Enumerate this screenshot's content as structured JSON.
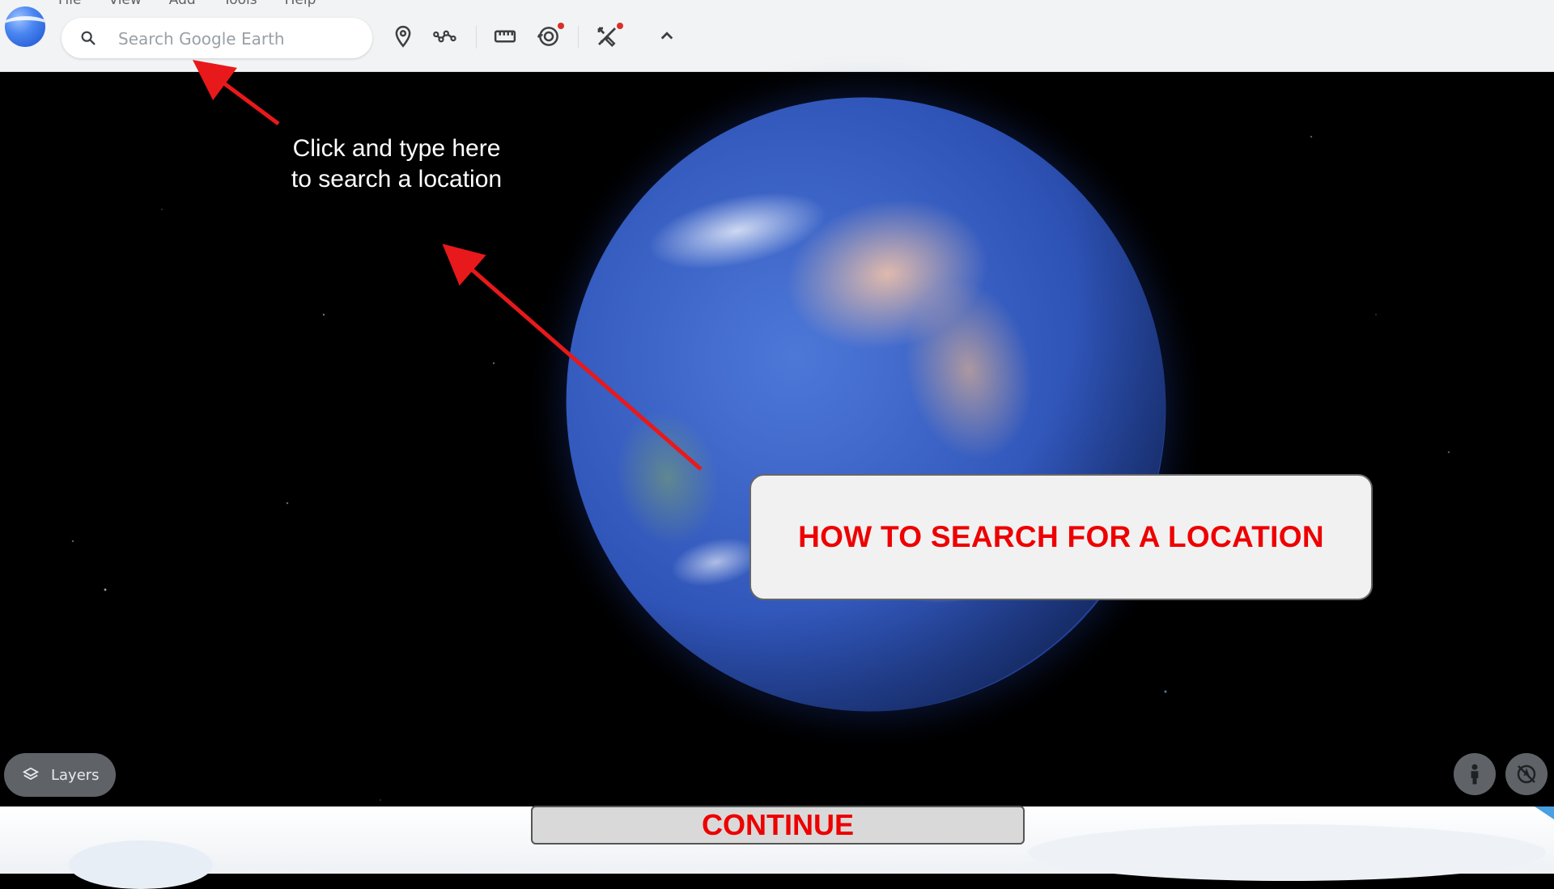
{
  "menu": [
    "File",
    "View",
    "Add",
    "Tools",
    "Help"
  ],
  "search": {
    "placeholder": "Search Google Earth",
    "value": ""
  },
  "toolbar": {
    "icons": [
      "place-marker-icon",
      "path-icon",
      "ruler-icon",
      "voyager-icon",
      "projects-icon",
      "collapse-chevron-icon"
    ],
    "notification_color": "#d93025"
  },
  "annotation": {
    "instruction_line1": "Click and type here",
    "instruction_line2": "to search a location",
    "arrow_color": "#e8191b"
  },
  "title_card": {
    "text": "HOW TO SEARCH FOR A LOCATION",
    "text_color": "#ee0000"
  },
  "layers": {
    "label": "Layers"
  },
  "map_controls": [
    "pegman-icon",
    "compass-icon"
  ],
  "continue": {
    "label": "CONTINUE"
  }
}
